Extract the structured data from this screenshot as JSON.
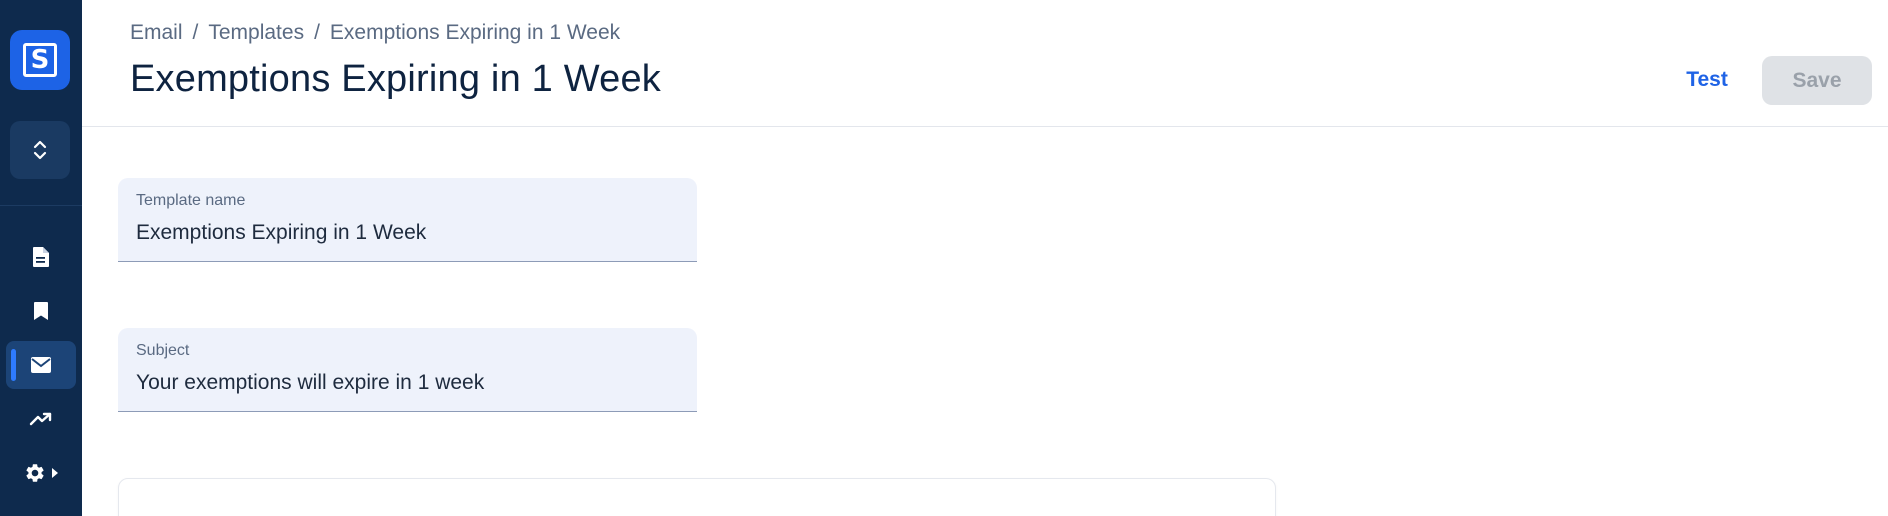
{
  "sidebar": {
    "logo_letter": "S",
    "nav": [
      {
        "icon": "document-icon",
        "active": false
      },
      {
        "icon": "bookmark-icon",
        "active": false
      },
      {
        "icon": "mail-icon",
        "active": true
      },
      {
        "icon": "trending-up-icon",
        "active": false
      },
      {
        "icon": "gear-icon",
        "active": false
      }
    ]
  },
  "header": {
    "breadcrumb": [
      "Email",
      "Templates",
      "Exemptions Expiring in 1 Week"
    ],
    "breadcrumb_separator": "/",
    "title": "Exemptions Expiring in 1 Week",
    "test_label": "Test",
    "save_label": "Save"
  },
  "form": {
    "template_name": {
      "label": "Template name",
      "value": "Exemptions Expiring in 1 Week"
    },
    "subject": {
      "label": "Subject",
      "value": "Your exemptions will expire in 1 week"
    }
  },
  "colors": {
    "sidebar_bg": "#0e2a4d",
    "accent": "#1f63e6",
    "field_bg": "#eef2fb",
    "save_disabled_bg": "#dfe2e6"
  }
}
